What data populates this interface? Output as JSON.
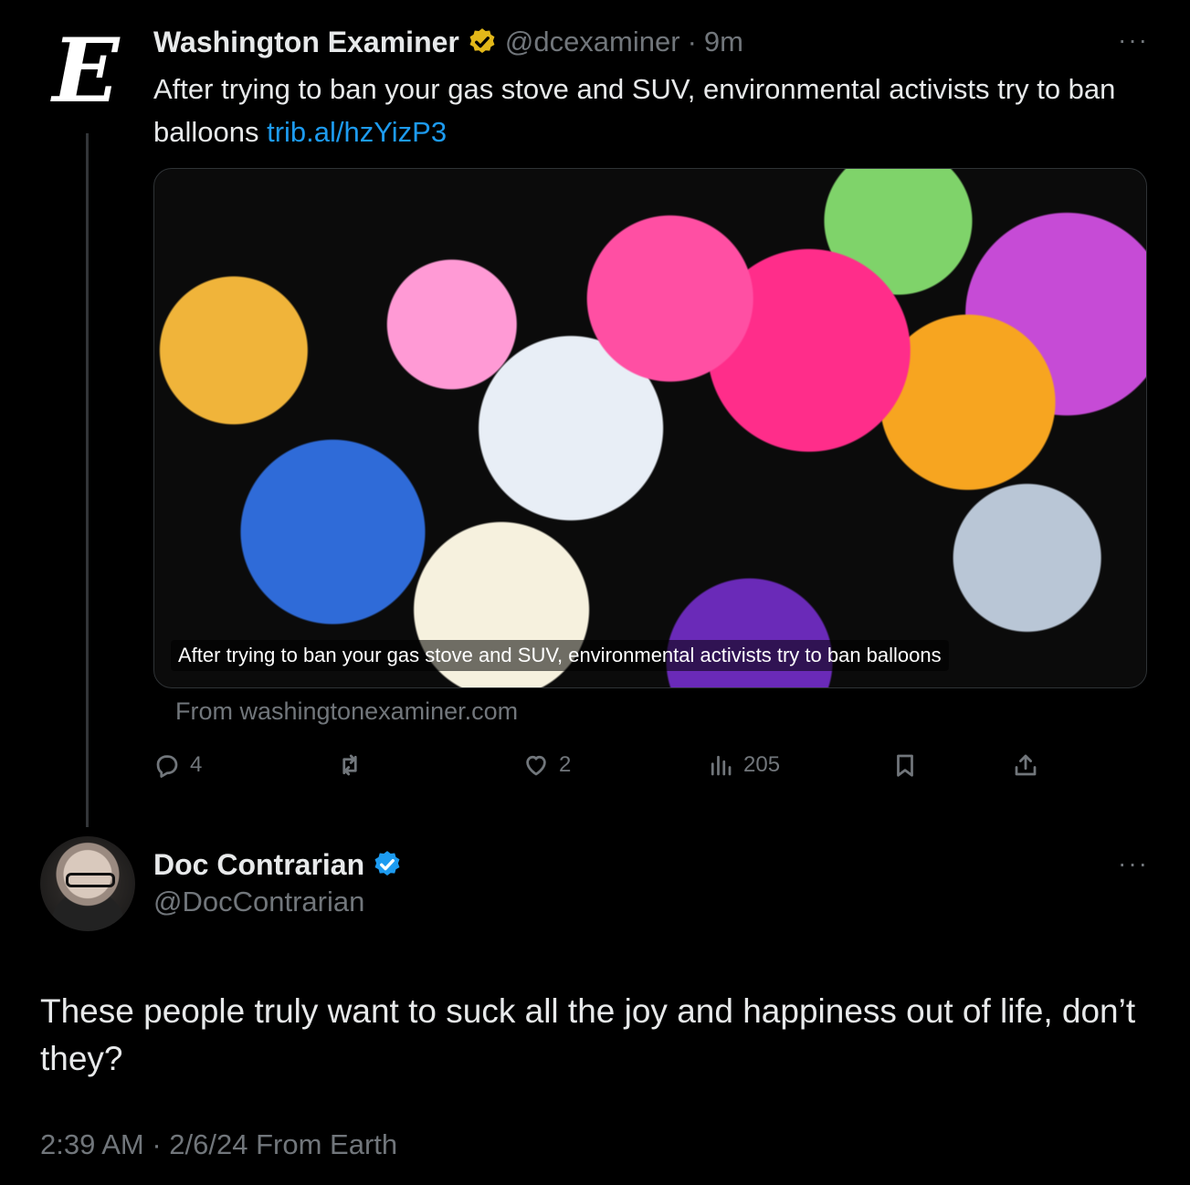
{
  "tweet1": {
    "avatar_glyph": "E",
    "name": "Washington Examiner",
    "verified_badge": "gold-verified-icon",
    "handle": "@dcexaminer",
    "separator": "·",
    "time": "9m",
    "more": "···",
    "text": "After trying to ban your gas stove and SUV, environmental activists try to ban balloons ",
    "link": "trib.al/hzYizP3",
    "card": {
      "caption": "After trying to ban your gas stove and SUV, environmental activists try to ban balloons",
      "source": "From washingtonexaminer.com"
    },
    "actions": {
      "replies": "4",
      "reposts": "",
      "likes": "2",
      "views": "205"
    }
  },
  "tweet2": {
    "name": "Doc Contrarian",
    "verified_badge": "blue-verified-icon",
    "handle": "@DocContrarian",
    "more": "···",
    "text": "These people truly want to suck all the joy and happiness out of life, don’t they?",
    "meta": "2:39 AM · 2/6/24 From Earth"
  },
  "colors": {
    "background": "#000000",
    "text": "#e7e9ea",
    "secondary": "#71767b",
    "link": "#1d9bf0",
    "gold_badge": "#e2b719",
    "blue_badge": "#1d9bf0"
  }
}
